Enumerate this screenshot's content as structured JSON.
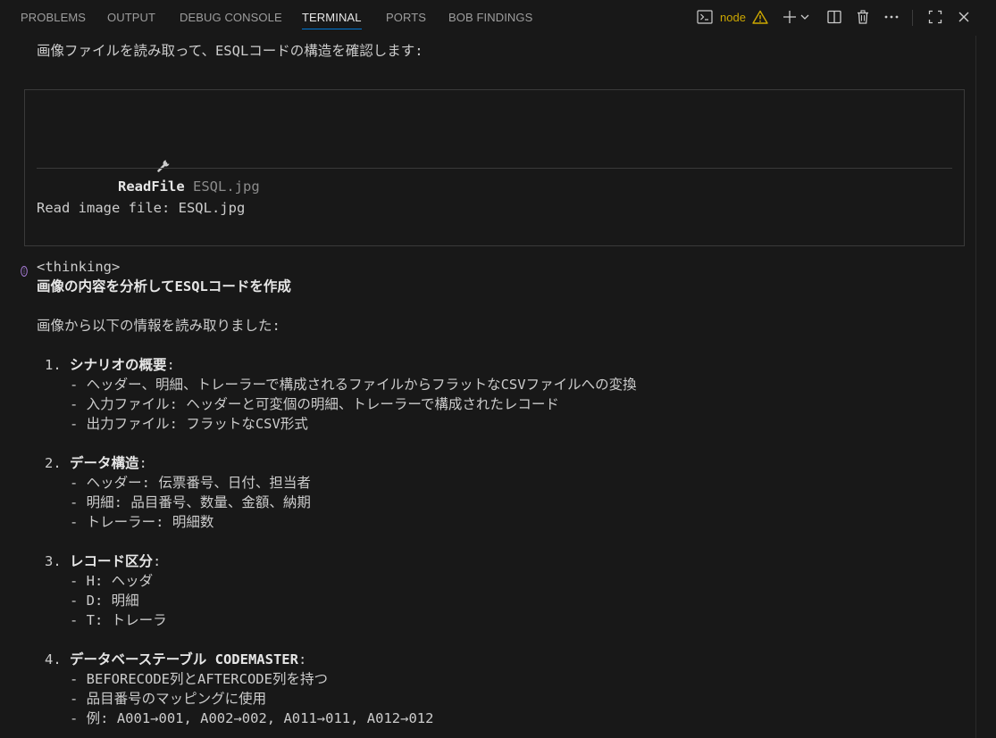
{
  "tabs": [
    {
      "label": "PROBLEMS",
      "active": false
    },
    {
      "label": "OUTPUT",
      "active": false
    },
    {
      "label": "DEBUG CONSOLE",
      "active": false
    },
    {
      "label": "TERMINAL",
      "active": true
    },
    {
      "label": "PORTS",
      "active": false
    },
    {
      "label": "BOB FINDINGS",
      "active": false
    }
  ],
  "toolbar": {
    "terminal_name": "node",
    "icons": [
      "terminal-icon",
      "warning-icon",
      "plus-icon",
      "chevron-down-icon",
      "split-icon",
      "trash-icon",
      "more-icon",
      "maximize-icon",
      "close-icon"
    ]
  },
  "terminal": {
    "intro": "画像ファイルを読み取って、ESQLコードの構造を確認します:",
    "tool": {
      "icon": "wrench-icon",
      "name": "ReadFile",
      "arg": "ESQL.jpg",
      "result": "Read image file: ESQL.jpg"
    },
    "thinking_tag": "<thinking>",
    "heading": "画像の内容を分析してESQLコードを作成",
    "summary": "画像から以下の情報を読み取りました:",
    "sections": [
      {
        "num": "1.",
        "title": "シナリオの概要",
        "items": [
          "- ヘッダー、明細、トレーラーで構成されるファイルからフラットなCSVファイルへの変換",
          "- 入力ファイル: ヘッダーと可変個の明細、トレーラーで構成されたレコード",
          "- 出力ファイル: フラットなCSV形式"
        ]
      },
      {
        "num": "2.",
        "title": "データ構造",
        "items": [
          "- ヘッダー: 伝票番号、日付、担当者",
          "- 明細: 品目番号、数量、金額、納期",
          "- トレーラー: 明細数"
        ]
      },
      {
        "num": "3.",
        "title": "レコード区分",
        "items": [
          "- H: ヘッダ",
          "- D: 明細",
          "- T: トレーラ"
        ]
      },
      {
        "num": "4.",
        "title": "データベーステーブル CODEMASTER",
        "items": [
          "- BEFORECODE列とAFTERCODE列を持つ",
          "- 品目番号のマッピングに使用",
          "- 例: A001→001, A002→002, A011→011, A012→012"
        ]
      }
    ]
  },
  "colors": {
    "background": "#181818",
    "text": "#cccccc",
    "accent": "#0078d4",
    "warning": "#cca700"
  }
}
